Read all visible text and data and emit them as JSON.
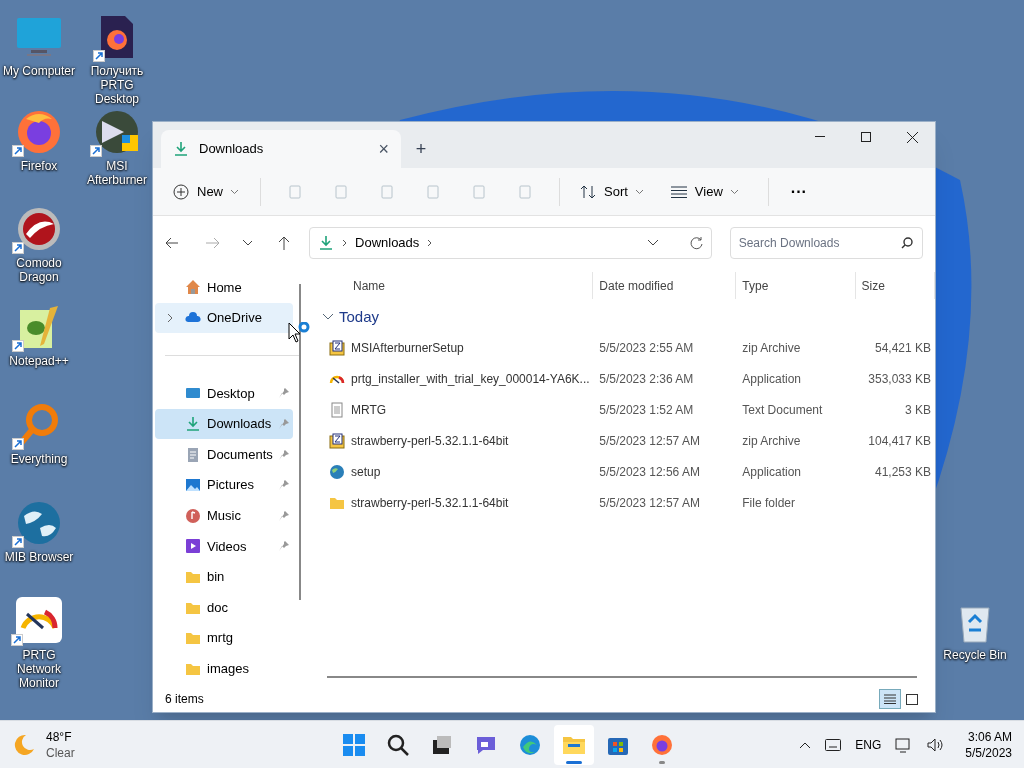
{
  "desktop_icons": [
    {
      "label": "My Computer",
      "kind": "monitor",
      "shortcut": false
    },
    {
      "label": "Получить PRTG Desktop",
      "kind": "firefox-doc",
      "shortcut": true
    },
    {
      "label": "Firefox",
      "kind": "firefox",
      "shortcut": true
    },
    {
      "label": "MSI Afterburner",
      "kind": "afterburner",
      "shortcut": true
    },
    {
      "label": "Comodo Dragon",
      "kind": "dragon",
      "shortcut": true
    },
    {
      "label": "Notepad++",
      "kind": "notepad",
      "shortcut": true
    },
    {
      "label": "Everything",
      "kind": "everything",
      "shortcut": true
    },
    {
      "label": "MIB Browser",
      "kind": "globe",
      "shortcut": true
    },
    {
      "label": "PRTG Network Monitor",
      "kind": "gauge",
      "shortcut": true
    },
    {
      "label": "Recycle Bin",
      "kind": "bin",
      "shortcut": false
    }
  ],
  "window": {
    "tab": {
      "title": "Downloads",
      "close": "×"
    },
    "new_tab": "+",
    "toolbar": {
      "new": "New",
      "sort": "Sort",
      "view": "View",
      "more": "···"
    },
    "address": {
      "path": "Downloads",
      "search_placeholder": "Search Downloads"
    },
    "sidebar": [
      {
        "label": "Home",
        "kind": "home",
        "pinned": false,
        "selected": false,
        "hovered": false
      },
      {
        "label": "OneDrive",
        "kind": "cloud",
        "pinned": false,
        "selected": false,
        "hovered": true,
        "expanded": false
      },
      {
        "label": "Desktop",
        "kind": "desktop",
        "pinned": true,
        "selected": false,
        "hovered": false
      },
      {
        "label": "Downloads",
        "kind": "download",
        "pinned": true,
        "selected": true,
        "hovered": false
      },
      {
        "label": "Documents",
        "kind": "documents",
        "pinned": true,
        "selected": false,
        "hovered": false
      },
      {
        "label": "Pictures",
        "kind": "pictures",
        "pinned": true,
        "selected": false,
        "hovered": false
      },
      {
        "label": "Music",
        "kind": "music",
        "pinned": true,
        "selected": false,
        "hovered": false
      },
      {
        "label": "Videos",
        "kind": "videos",
        "pinned": true,
        "selected": false,
        "hovered": false
      },
      {
        "label": "bin",
        "kind": "folder",
        "pinned": false,
        "selected": false,
        "hovered": false
      },
      {
        "label": "doc",
        "kind": "folder",
        "pinned": false,
        "selected": false,
        "hovered": false
      },
      {
        "label": "mrtg",
        "kind": "folder",
        "pinned": false,
        "selected": false,
        "hovered": false
      },
      {
        "label": "images",
        "kind": "folder",
        "pinned": false,
        "selected": false,
        "hovered": false
      }
    ],
    "columns": [
      "Name",
      "Date modified",
      "Type",
      "Size"
    ],
    "group": {
      "title": "Today",
      "expanded": true
    },
    "rows": [
      {
        "name": "MSIAfterburnerSetup",
        "date": "5/5/2023 2:55 AM",
        "type": "zip Archive",
        "size": "54,421 KB",
        "kind": "zip"
      },
      {
        "name": "prtg_installer_with_trial_key_000014-YA6K...",
        "date": "5/5/2023 2:36 AM",
        "type": "Application",
        "size": "353,033 KB",
        "kind": "gauge"
      },
      {
        "name": "MRTG",
        "date": "5/5/2023 1:52 AM",
        "type": "Text Document",
        "size": "3 KB",
        "kind": "text"
      },
      {
        "name": "strawberry-perl-5.32.1.1-64bit",
        "date": "5/5/2023 12:57 AM",
        "type": "zip Archive",
        "size": "104,417 KB",
        "kind": "zip"
      },
      {
        "name": "setup",
        "date": "5/5/2023 12:56 AM",
        "type": "Application",
        "size": "41,253 KB",
        "kind": "globe"
      },
      {
        "name": "strawberry-perl-5.32.1.1-64bit",
        "date": "5/5/2023 12:57 AM",
        "type": "File folder",
        "size": "",
        "kind": "folder"
      }
    ],
    "status": "6 items",
    "view_buttons": [
      {
        "kind": "details",
        "selected": true
      },
      {
        "kind": "tiles",
        "selected": false
      }
    ]
  },
  "taskbar": {
    "weather": {
      "temp": "48°F",
      "condition": "Clear"
    },
    "apps": [
      {
        "kind": "start",
        "selected": false,
        "running": false
      },
      {
        "kind": "search",
        "selected": false,
        "running": false
      },
      {
        "kind": "taskview",
        "selected": false,
        "running": false
      },
      {
        "kind": "chat",
        "selected": false,
        "running": false
      },
      {
        "kind": "edge",
        "selected": false,
        "running": false
      },
      {
        "kind": "explorer",
        "selected": true,
        "running": true
      },
      {
        "kind": "store",
        "selected": false,
        "running": false
      },
      {
        "kind": "firefox",
        "selected": false,
        "running": true
      }
    ],
    "language": "ENG",
    "time": "3:06 AM",
    "date": "5/5/2023"
  }
}
